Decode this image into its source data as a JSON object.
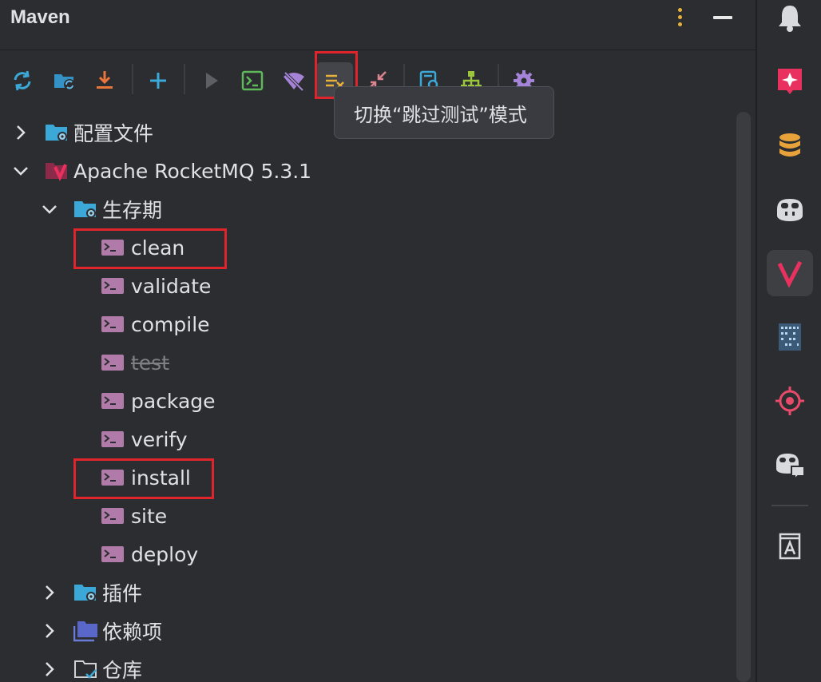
{
  "window": {
    "title": "Maven"
  },
  "toolbar": {
    "tooltip": "切换“跳过测试”模式",
    "buttons": [
      {
        "name": "reload-icon"
      },
      {
        "name": "generate-sources-icon"
      },
      {
        "name": "download-icon"
      },
      {
        "name": "add-icon"
      },
      {
        "name": "run-icon"
      },
      {
        "name": "execute-goal-icon"
      },
      {
        "name": "offline-mode-icon"
      },
      {
        "name": "skip-tests-icon"
      },
      {
        "name": "collapse-icon"
      },
      {
        "name": "show-effective-pom-icon"
      },
      {
        "name": "dependency-diagram-icon"
      },
      {
        "name": "settings-icon"
      }
    ]
  },
  "tree": {
    "profiles": "配置文件",
    "project": "Apache RocketMQ 5.3.1",
    "lifecycle": "生存期",
    "goals": [
      "clean",
      "validate",
      "compile",
      "test",
      "package",
      "verify",
      "install",
      "site",
      "deploy"
    ],
    "plugins": "插件",
    "dependencies": "依赖项",
    "repositories": "仓库"
  },
  "colors": {
    "background": "#2b2d30",
    "highlight": "#e0242b",
    "maven": "#c8245a",
    "folder": "#3ca8d8",
    "goal": "#b07ba8"
  }
}
